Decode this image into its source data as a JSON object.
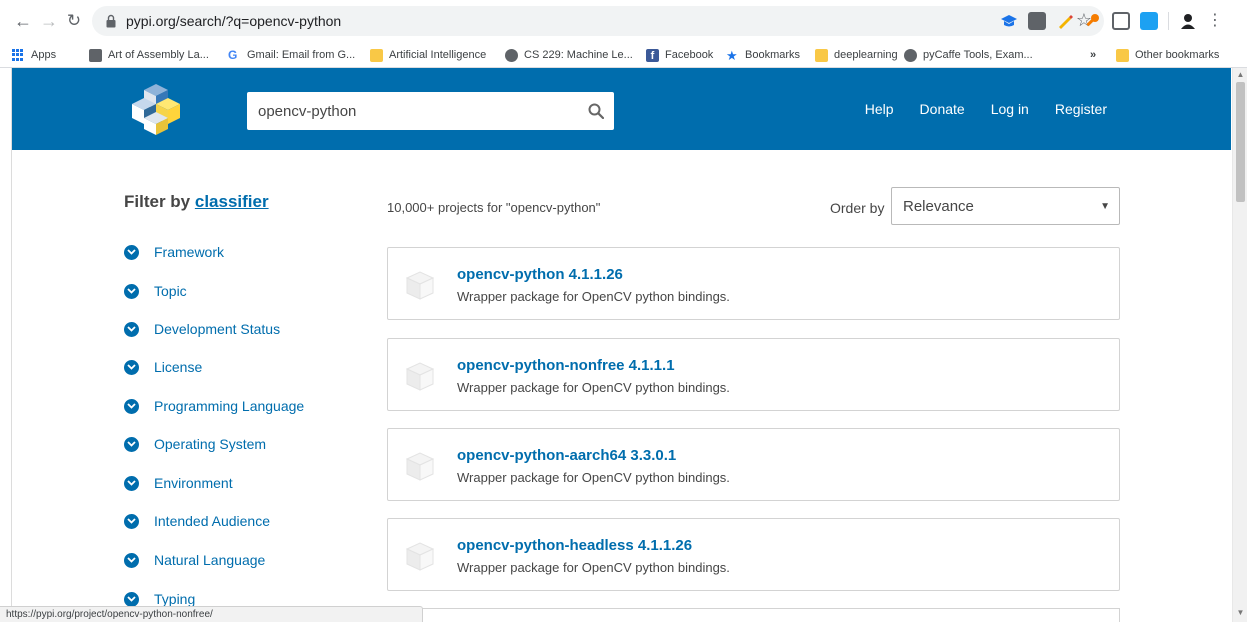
{
  "browser": {
    "url": "pypi.org/search/?q=opencv-python",
    "status_url": "https://pypi.org/project/opencv-python-nonfree/",
    "bookmarks": [
      {
        "label": "Apps",
        "icon": "apps-grid-icon"
      },
      {
        "label": "Art of Assembly La...",
        "icon": "page-icon"
      },
      {
        "label": "Gmail: Email from G...",
        "icon": "google-icon"
      },
      {
        "label": "Artificial Intelligence",
        "icon": "folder-icon"
      },
      {
        "label": "CS 229: Machine Le...",
        "icon": "globe-icon"
      },
      {
        "label": "Facebook",
        "icon": "facebook-icon"
      },
      {
        "label": "Bookmarks",
        "icon": "star-icon"
      },
      {
        "label": "deeplearning",
        "icon": "folder-icon"
      },
      {
        "label": "pyCaffe Tools, Exam...",
        "icon": "globe-icon"
      }
    ],
    "overflow_label": "»",
    "other_bookmarks": "Other bookmarks"
  },
  "header": {
    "search_value": "opencv-python",
    "nav": [
      "Help",
      "Donate",
      "Log in",
      "Register"
    ]
  },
  "sidebar": {
    "title_prefix": "Filter by",
    "title_link": "classifier",
    "filters": [
      "Framework",
      "Topic",
      "Development Status",
      "License",
      "Programming Language",
      "Operating System",
      "Environment",
      "Intended Audience",
      "Natural Language",
      "Typing"
    ]
  },
  "results": {
    "count_text": "10,000+ projects for \"opencv-python\"",
    "order_label": "Order by",
    "order_value": "Relevance",
    "items": [
      {
        "name": "opencv-python 4.1.1.26",
        "description": "Wrapper package for OpenCV python bindings."
      },
      {
        "name": "opencv-python-nonfree 4.1.1.1",
        "description": "Wrapper package for OpenCV python bindings."
      },
      {
        "name": "opencv-python-aarch64 3.3.0.1",
        "description": "Wrapper package for OpenCV python bindings."
      },
      {
        "name": "opencv-python-headless 4.1.1.26",
        "description": "Wrapper package for OpenCV python bindings."
      }
    ]
  },
  "colors": {
    "brand_blue": "#006dad",
    "text": "#464646",
    "card_border": "#d3d3d3"
  }
}
